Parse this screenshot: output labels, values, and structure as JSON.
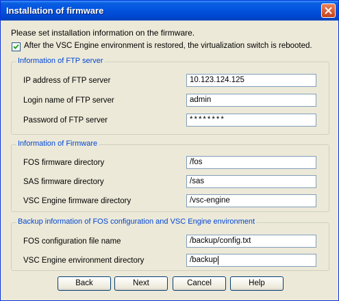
{
  "window": {
    "title": "Installation of firmware"
  },
  "intro_text": "Please set installation information on the firmware.",
  "reboot_option": {
    "label": "After the VSC Engine environment is restored, the virtualization switch is rebooted.",
    "checked": true
  },
  "ftp_group": {
    "legend": "Information of FTP server",
    "fields": [
      {
        "label": "IP address of FTP server",
        "value": "10.123.124.125"
      },
      {
        "label": "Login name of FTP server",
        "value": "admin"
      },
      {
        "label": "Password of FTP server",
        "value": "********"
      }
    ]
  },
  "firmware_group": {
    "legend": "Information of Firmware",
    "fields": [
      {
        "label": "FOS firmware directory",
        "value": "/fos"
      },
      {
        "label": "SAS firmware directory",
        "value": "/sas"
      },
      {
        "label": "VSC Engine firmware directory",
        "value": "/vsc-engine"
      }
    ]
  },
  "backup_group": {
    "legend": "Backup information of FOS configuration and VSC Engine environment",
    "fields": [
      {
        "label": "FOS configuration file name",
        "value": "/backup/config.txt"
      },
      {
        "label": "VSC Engine environment directory",
        "value": "/backup"
      }
    ]
  },
  "buttons": {
    "back": "Back",
    "next": "Next",
    "cancel": "Cancel",
    "help": "Help"
  },
  "icons": {
    "close": "close-icon",
    "check": "checkmark-icon"
  },
  "colors": {
    "titlebar": "#0054e3",
    "legend_text": "#0046d5",
    "window_bg": "#ece9d8",
    "checkmark": "#21a121"
  }
}
